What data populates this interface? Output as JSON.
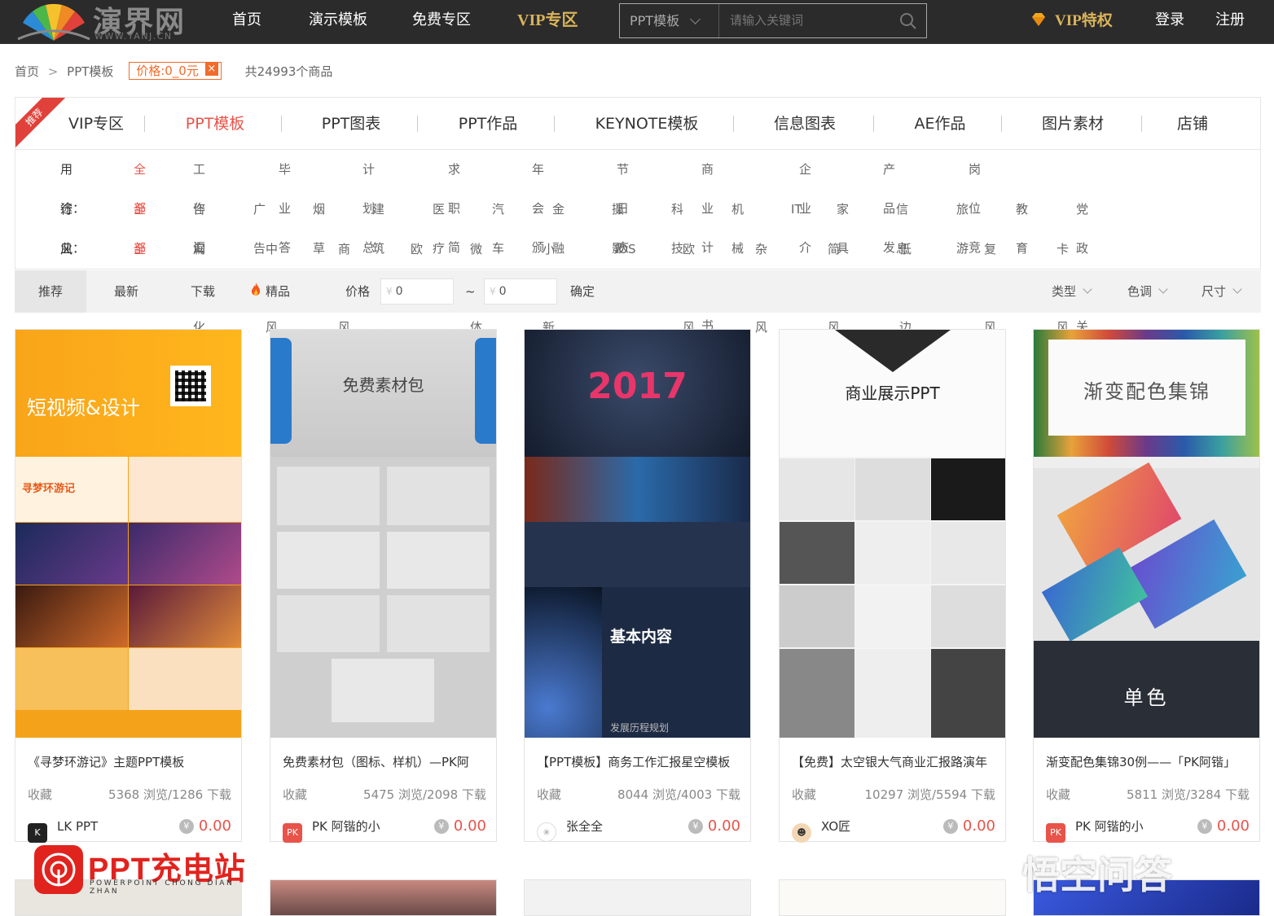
{
  "header": {
    "logo_name": "演界网",
    "logo_url": "WWW.YANJ.CN",
    "nav": [
      "首页",
      "演示模板",
      "免费专区",
      "VIP专区"
    ],
    "search": {
      "category": "PPT模板",
      "placeholder": "请输入关键词"
    },
    "vip_label": "VIP特权",
    "login": "登录",
    "register": "注册"
  },
  "breadcrumb": {
    "home": "首页",
    "sep": ">",
    "current": "PPT模板",
    "filter_tag": "价格:0_0元",
    "filter_close": "×",
    "count": "共24993个商品"
  },
  "categories": {
    "ribbon": "推荐",
    "items": [
      "VIP专区",
      "PPT模板",
      "PPT图表",
      "PPT作品",
      "KEYNOTE模板",
      "信息图表",
      "AE作品",
      "图片素材",
      "店铺"
    ],
    "active": "PPT模板"
  },
  "filters": {
    "usage": {
      "label": "用途：",
      "items": [
        "全部",
        "工作汇报",
        "毕业答辩",
        "计划总结",
        "求职简历",
        "年会颁奖",
        "节日庆典",
        "商业计划书",
        "企业介绍",
        "产品发布",
        "岗位竞聘"
      ]
    },
    "industry": {
      "label": "行业：",
      "items": [
        "全部",
        "咨询",
        "广告",
        "烟草",
        "建筑",
        "医疗",
        "汽车",
        "金融",
        "摄影",
        "科技",
        "机械",
        "IT",
        "家具",
        "信息",
        "旅游",
        "教育",
        "党政机关"
      ]
    },
    "style": {
      "label": "风格：",
      "items": [
        "全部",
        "扁平化",
        "中国风",
        "商务风",
        "欧式",
        "微立体",
        "小清新",
        "iOS风",
        "欧美风",
        "杂志风",
        "简约风",
        "低多边形",
        "复古风",
        "卡通风"
      ]
    }
  },
  "sortbar": {
    "items": [
      "推荐",
      "最新",
      "下载",
      "精品"
    ],
    "price_label": "价格",
    "min": "0",
    "max": "0",
    "yen": "¥",
    "tilde": "~",
    "confirm": "确定",
    "dropdowns": [
      "类型",
      "色调",
      "尺寸"
    ]
  },
  "products": [
    {
      "title": "《寻梦环游记》主题PPT模板",
      "fav": "收藏",
      "stats": "5368 浏览/1286 下载",
      "author": "LK PPT",
      "price": "0.00",
      "thumb_text": [
        "短视频&设计",
        "寻梦环游记"
      ]
    },
    {
      "title": "免费素材包（图标、样机）—PK阿",
      "fav": "收藏",
      "stats": "5475 浏览/2098 下载",
      "author": "PK 阿锴的小",
      "price": "0.00",
      "thumb_text": [
        "免费素材包"
      ]
    },
    {
      "title": "【PPT模板】商务工作汇报星空模板",
      "fav": "收藏",
      "stats": "8044 浏览/4003 下载",
      "author": "张全全",
      "price": "0.00",
      "thumb_text": [
        "2017",
        "基本内容",
        "发展历程规划"
      ]
    },
    {
      "title": "【免费】太空银大气商业汇报路演年",
      "fav": "收藏",
      "stats": "10297 浏览/5594 下载",
      "author": "XO匠",
      "price": "0.00",
      "thumb_text": [
        "商业展示PPT"
      ]
    },
    {
      "title": "渐变配色集锦30例——「PK阿锴」",
      "fav": "收藏",
      "stats": "5811 浏览/3284 下载",
      "author": "PK 阿锴的小",
      "price": "0.00",
      "thumb_text": [
        "渐变配色集锦",
        "单色"
      ]
    }
  ],
  "watermarks": {
    "left_title": "PPT充电站",
    "left_sub": "POWERPOINT CHONG DIAN ZHAN",
    "right": "悟空问答"
  },
  "colors": {
    "topbar": "#2b2b2b",
    "accent": "#e8534a",
    "vip_gold": "#d9b45a"
  }
}
